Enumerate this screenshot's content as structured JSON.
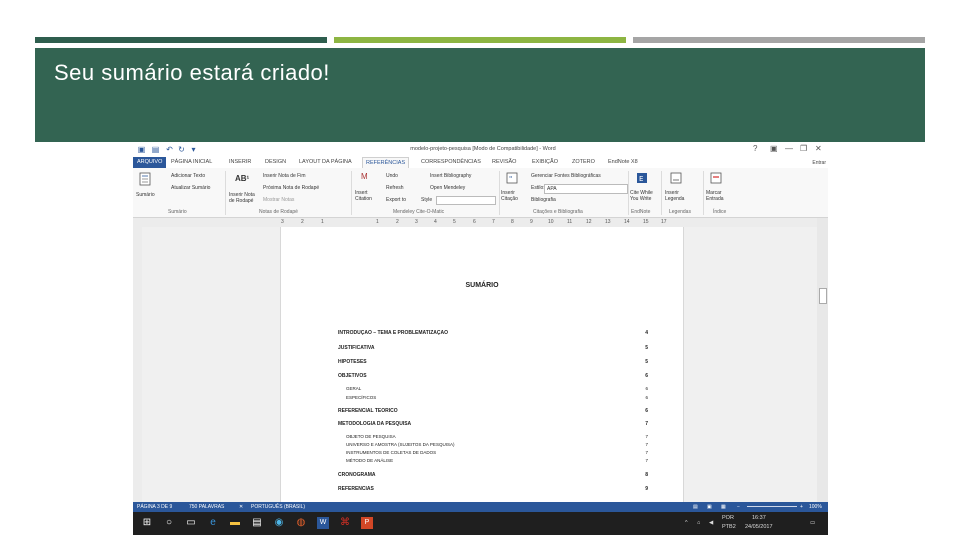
{
  "slide": {
    "title": "Seu sumário estará criado!",
    "colors": {
      "bar_dark_green": "#2e5e4e",
      "bar_light_green": "#8db542",
      "bar_gray": "#a5a5a5",
      "header_bg": "#336452"
    }
  },
  "word": {
    "doc_title": "modelo-projeto-pesquisa [Modo de Compatibilidade] - Word",
    "signin": "Entrar",
    "tabs": [
      "ARQUIVO",
      "PÁGINA INICIAL",
      "INSERIR",
      "DESIGN",
      "LAYOUT DA PÁGINA",
      "REFERÊNCIAS",
      "CORRESPONDÊNCIAS",
      "REVISÃO",
      "EXIBIÇÃO",
      "ZOTERO",
      "EndNote X8"
    ],
    "ribbon": {
      "sumario_btn": "Sumário",
      "adicionar_texto": "Adicionar Texto",
      "atualizar_sumario": "Atualizar Sumário",
      "inserir_nota_rodape": "Inserir Nota de Rodapé",
      "inserir_nota_fim": "Inserir Nota de Fim",
      "proxima_nota": "Próxima Nota de Rodapé",
      "mostrar_notas": "Mostrar Notas",
      "undo": "Undo",
      "refresh": "Refresh",
      "insert_citation": "Insert Citation",
      "export_to": "Export to",
      "style_label": "Style",
      "insert_bibliography": "Insert Bibliography",
      "open_mendeley": "Open Mendeley",
      "inserir_citacao": "Inserir Citação",
      "gerenciar_fontes": "Gerenciar Fontes Bibliográficas",
      "estilo_label": "Estilo:",
      "estilo_value": "APA",
      "bibliografia": "Bibliografia",
      "cite_while": "Cite While You Write",
      "inserir_legenda": "Inserir Legenda",
      "marcar_entrada": "Marcar Entrada",
      "groups": [
        "Sumário",
        "Notas de Rodapé",
        "Mendeley Cite-O-Matic",
        "Citações e Bibliografia",
        "EndNote",
        "Legendas",
        "Índice"
      ]
    },
    "ruler_numbers": [
      "3",
      "2",
      "1",
      "1",
      "2",
      "3",
      "4",
      "5",
      "6",
      "7",
      "8",
      "9",
      "10",
      "11",
      "12",
      "13",
      "14",
      "15",
      "17"
    ],
    "toc": {
      "heading": "SUMÁRIO",
      "entries": [
        {
          "text": "INTRODUÇÃO – TEMA E PROBLEMATIZAÇÃO",
          "page": "4",
          "level": 1
        },
        {
          "text": "JUSTIFICATIVA",
          "page": "5",
          "level": 1
        },
        {
          "text": "HIPÓTESES",
          "page": "5",
          "level": 1
        },
        {
          "text": "OBJETIVOS",
          "page": "6",
          "level": 1
        },
        {
          "text": "GERAL",
          "page": "6",
          "level": 2
        },
        {
          "text": "ESPECÍFICOS",
          "page": "6",
          "level": 2
        },
        {
          "text": "REFERENCIAL TEÓRICO",
          "page": "6",
          "level": 1
        },
        {
          "text": "METODOLOGIA DA PESQUISA",
          "page": "7",
          "level": 1
        },
        {
          "text": "OBJETO DE PESQUISA",
          "page": "7",
          "level": 2
        },
        {
          "text": "UNIVERSO E AMOSTRA (SUJEITOS DA PESQUISA)",
          "page": "7",
          "level": 2
        },
        {
          "text": "INSTRUMENTOS DE COLETAS DE DADOS",
          "page": "7",
          "level": 2
        },
        {
          "text": "MÉTODO DE ANÁLISE",
          "page": "7",
          "level": 2
        },
        {
          "text": "CRONOGRAMA",
          "page": "8",
          "level": 1
        },
        {
          "text": "REFERÊNCIAS",
          "page": "9",
          "level": 1
        }
      ]
    },
    "status": {
      "page": "PÁGINA 3 DE 9",
      "words": "750 PALAVRAS",
      "language": "PORTUGUÊS (BRASIL)",
      "zoom": "100%"
    },
    "taskbar": {
      "lang": "POR",
      "layout": "PTB2",
      "time": "16:37",
      "date": "24/05/2017"
    }
  }
}
